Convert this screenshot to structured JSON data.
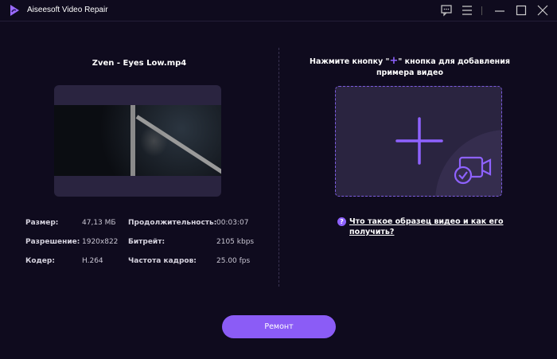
{
  "window": {
    "title": "Aiseesoft Video Repair"
  },
  "left": {
    "file_name": "Zven - Eyes Low.mp4",
    "info": [
      {
        "label": "Размер:",
        "value": "47,13 МБ"
      },
      {
        "label": "Разрешение:",
        "value": "1920x822"
      },
      {
        "label": "Кодер:",
        "value": "H.264"
      },
      {
        "label": "Продолжительность:",
        "value": "00:03:07"
      },
      {
        "label": "Битрейт:",
        "value": "2105 kbps"
      },
      {
        "label": "Частота кадров:",
        "value": "25.00 fps"
      }
    ]
  },
  "right": {
    "title_pre": "Нажмите кнопку \"",
    "title_plus": "+",
    "title_post": "\" кнопка для добавления примера видео",
    "help_link": "Что такое образец видео и как его получить?",
    "help_icon": "?"
  },
  "repair_label": "Ремонт",
  "colors": {
    "accent": "#8b5cf6",
    "bg": "#0f0b1e",
    "panel": "#2a2440"
  }
}
